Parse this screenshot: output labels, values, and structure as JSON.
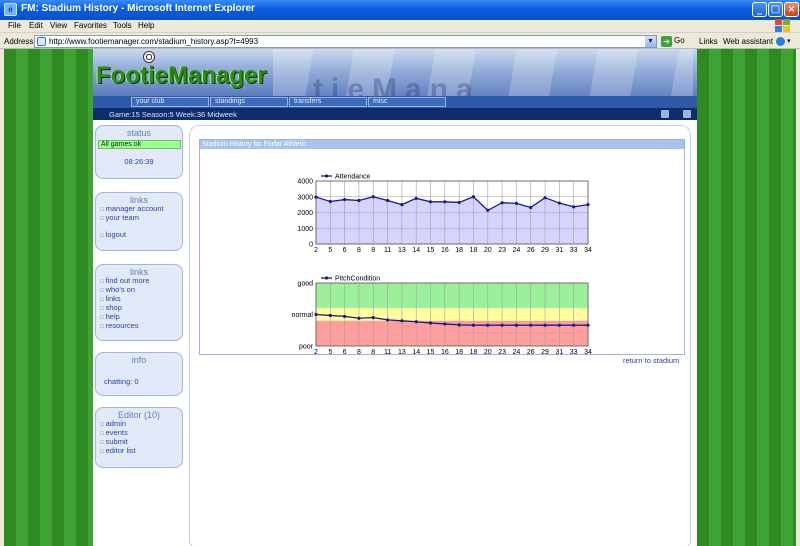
{
  "window": {
    "title": "FM: Stadium History - Microsoft Internet Explorer",
    "buttons": {
      "minimize": "_",
      "maximize": "□",
      "close": "×"
    }
  },
  "menu": [
    "File",
    "Edit",
    "View",
    "Favorites",
    "Tools",
    "Help"
  ],
  "address": {
    "label": "Address",
    "url": "http://www.footiemanager.com/stadium_history.asp?t=4993",
    "go_label": "Go",
    "links_label": "Links",
    "assistant_label": "Web assistant"
  },
  "site": {
    "logo": "FootieManager",
    "banner_ghost": "tieMana",
    "nav": [
      "your club",
      "standings",
      "transfers",
      "misc"
    ],
    "info_text": "Game:15  Season:5  Week:36 Midweek"
  },
  "sidebar": {
    "status": {
      "title": "status",
      "message": "All games ok",
      "time": "08:26:39"
    },
    "links1": {
      "title": "links",
      "items": [
        "manager account",
        "your team",
        "logout"
      ]
    },
    "links2": {
      "title": "links",
      "items": [
        "find out more",
        "who's on",
        "links",
        "shop",
        "help",
        "resources"
      ]
    },
    "info": {
      "title": "info",
      "chatting": "chatting: 0"
    },
    "editor": {
      "title": "Editor (10)",
      "items": [
        "admin",
        "events",
        "submit",
        "editor list"
      ]
    }
  },
  "stadium": {
    "heading": "Stadium History for Forfar Athletic",
    "return_link": "return to stadium"
  },
  "chart_data": [
    {
      "type": "area",
      "legend": "Attendance",
      "x": [
        2,
        5,
        6,
        8,
        8,
        11,
        13,
        14,
        15,
        16,
        18,
        18,
        20,
        23,
        24,
        26,
        29,
        31,
        33,
        34
      ],
      "values": [
        2980,
        2700,
        2820,
        2760,
        3000,
        2760,
        2500,
        2900,
        2680,
        2680,
        2640,
        3000,
        2140,
        2620,
        2580,
        2320,
        2940,
        2600,
        2360,
        2500
      ],
      "ylim": [
        0,
        4000
      ],
      "yticks": [
        0,
        1000,
        2000,
        3000,
        4000
      ],
      "color": "#1a1a8c",
      "fill": "#d4d4ff"
    },
    {
      "type": "line",
      "legend": "PitchCondition",
      "x": [
        2,
        5,
        6,
        8,
        8,
        11,
        13,
        14,
        15,
        16,
        18,
        18,
        20,
        23,
        24,
        26,
        29,
        31,
        33,
        34
      ],
      "values": [
        0.0,
        -0.03,
        -0.06,
        -0.12,
        -0.1,
        -0.17,
        -0.2,
        -0.23,
        -0.27,
        -0.3,
        -0.33,
        -0.34,
        -0.34,
        -0.34,
        -0.34,
        -0.34,
        -0.34,
        -0.34,
        -0.34,
        -0.34
      ],
      "ylim": [
        -1,
        1
      ],
      "yticks": [
        {
          "value": -1,
          "label": "poor"
        },
        {
          "value": 0,
          "label": "normal"
        },
        {
          "value": 1,
          "label": "good"
        }
      ],
      "bands": [
        {
          "from": 0.2,
          "to": 1,
          "color": "#9cf09c"
        },
        {
          "from": -0.2,
          "to": 0.2,
          "color": "#ffff9e"
        },
        {
          "from": -1,
          "to": -0.2,
          "color": "#ff9e9e"
        }
      ],
      "color": "#1a1a8c"
    }
  ]
}
